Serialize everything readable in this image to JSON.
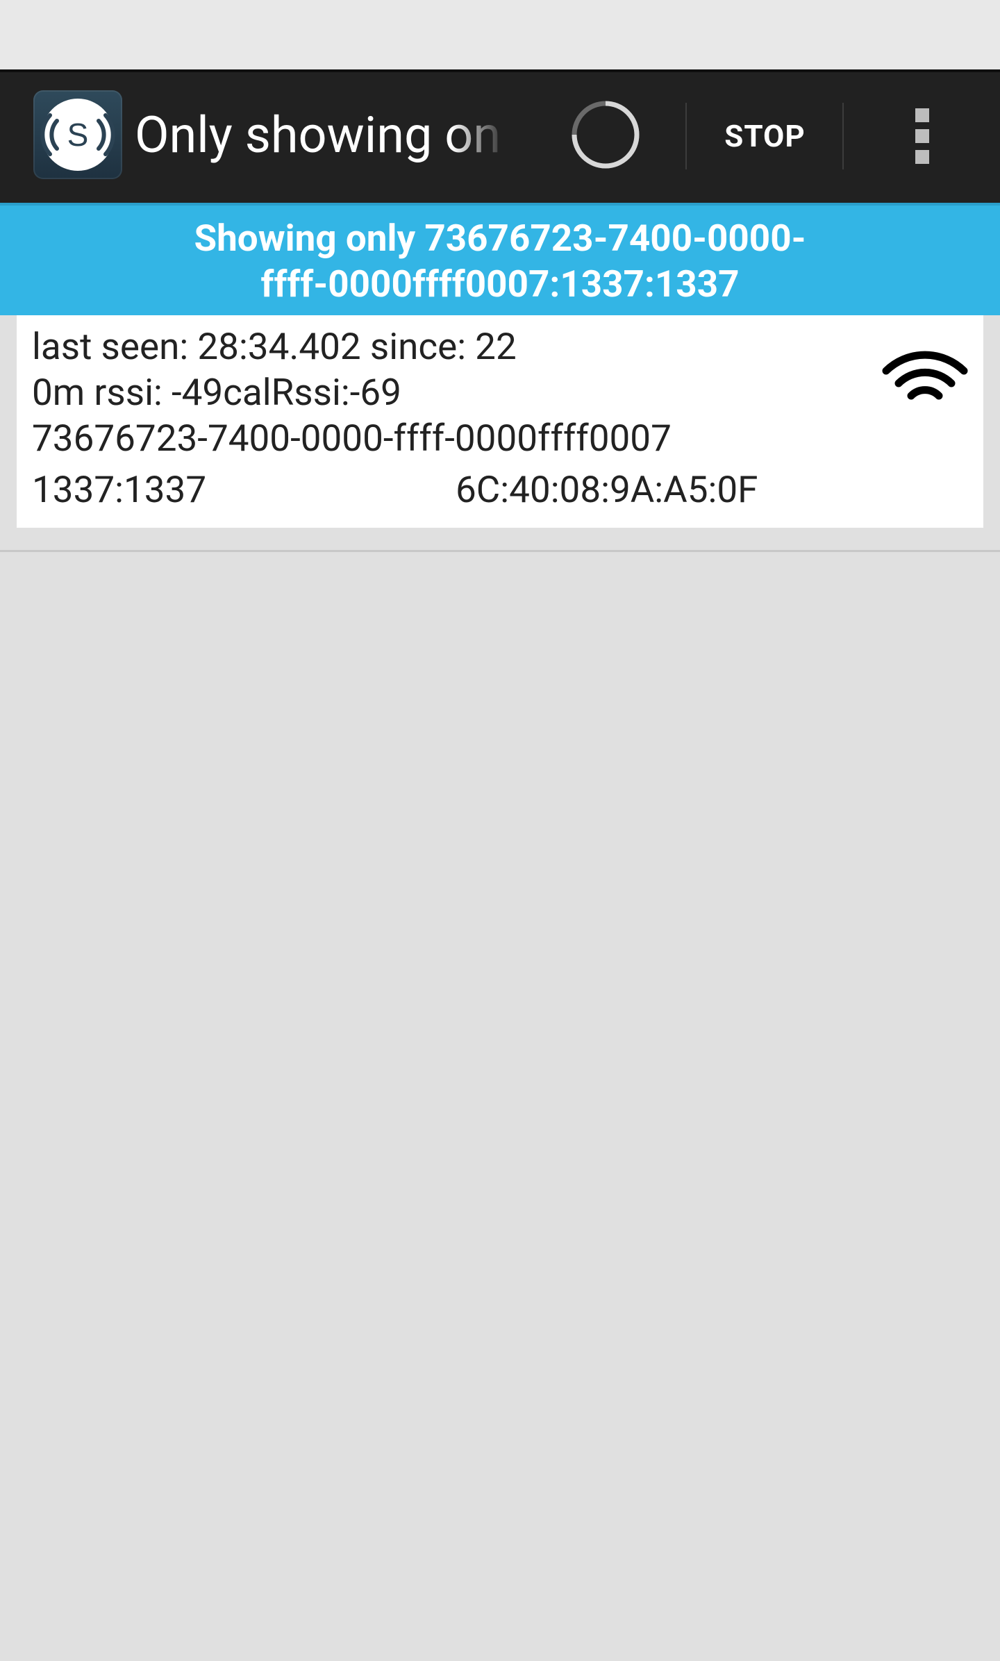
{
  "action_bar": {
    "title": "Only showing on",
    "stop_label": "STOP",
    "icons": {
      "app": "signal-s-app-icon",
      "progress": "progress-spinner-icon",
      "overflow": "overflow-menu-icon"
    },
    "colors": {
      "background": "#212121",
      "text": "#ffffff"
    }
  },
  "banner": {
    "line1": "Showing only 73676723-7400-0000-",
    "line2": "ffff-0000ffff0007:1337:1337",
    "color": "#33b5e5"
  },
  "beacon": {
    "line1": "last seen: 28:34.402 since: 22",
    "line2": "0m rssi: -49calRssi:-69",
    "uuid": "73676723-7400-0000-ffff-0000ffff0007",
    "major_minor": "1337:1337",
    "mac": "6C:40:08:9A:A5:0F",
    "signal_icon": "wifi-signal-icon"
  }
}
